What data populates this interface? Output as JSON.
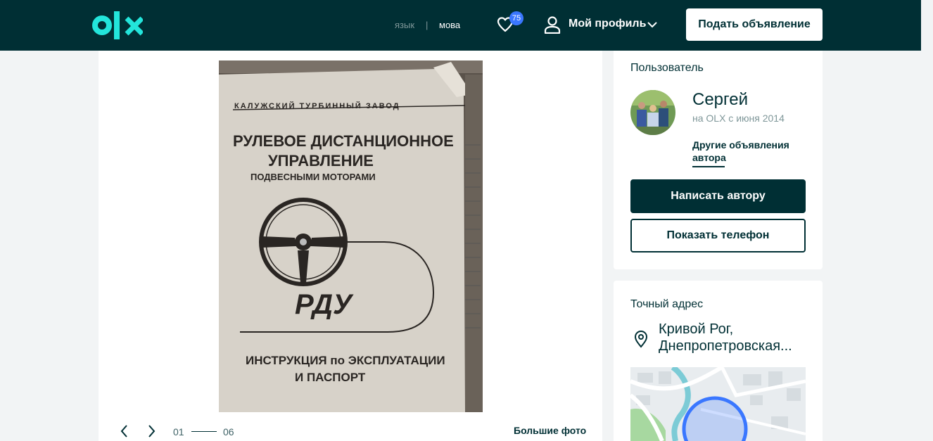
{
  "header": {
    "logo_text": "OLX",
    "lang_ru": "язык",
    "lang_separator": "|",
    "lang_ua": "мова",
    "favorites_count": "75",
    "profile_label": "Мой профиль",
    "post_ad_label": "Подать объявление"
  },
  "gallery": {
    "photo_texts": [
      "КАЛУЖСКИЙ ТУРБИННЫЙ ЗАВОД",
      "РУЛЕВОЕ ДИСТАНЦИОННОЕ",
      "УПРАВЛЕНИЕ",
      "ПОДВЕСНЫМИ МОТОРАМИ",
      "РДУ",
      "ИНСТРУКЦИЯ по ЭКСПЛУАТАЦИИ",
      "И ПАСПОРТ"
    ],
    "current": "01",
    "total": "06",
    "big_photos_label": "Большие фото"
  },
  "user_card": {
    "title": "Пользователь",
    "name": "Сергей",
    "since": "на OLX с июня 2014",
    "other_ads_label": "Другие объявления автора",
    "write_label": "Написать автору",
    "phone_label": "Показать телефон"
  },
  "address_card": {
    "title": "Точный адрес",
    "line1": "Кривой Рог,",
    "line2": "Днепропетровская..."
  },
  "colors": {
    "brand_dark": "#002f34",
    "accent_teal": "#23e5db",
    "badge_blue": "#3a77ff",
    "page_bg": "#f2f4f5"
  },
  "icons": [
    "olx-logo",
    "heart-icon",
    "user-icon",
    "chevron-down-icon",
    "chevron-left-icon",
    "chevron-right-icon",
    "location-pin-icon"
  ]
}
